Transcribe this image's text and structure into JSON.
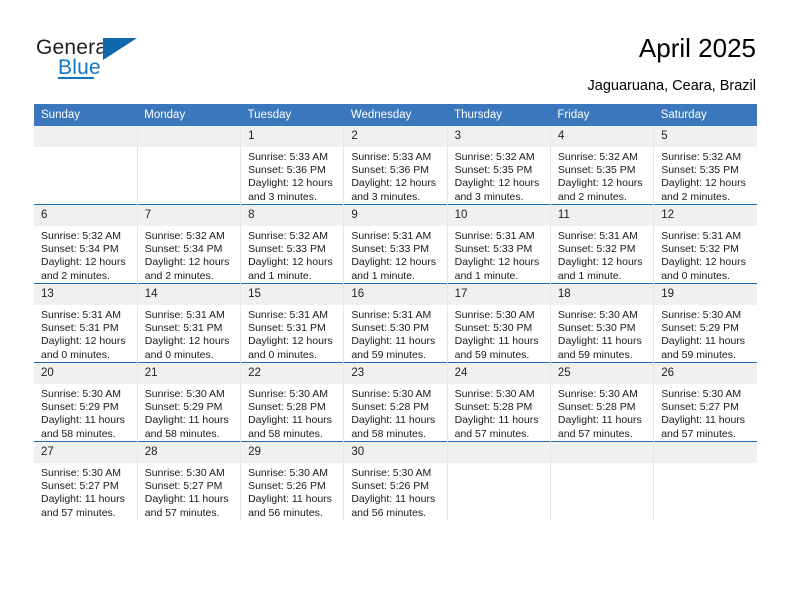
{
  "logo": {
    "word_one": "General",
    "word_two": "Blue",
    "triangle_icon": "triangle-icon"
  },
  "header": {
    "title": "April 2025",
    "location": "Jaguaruana, Ceara, Brazil"
  },
  "colors": {
    "header_blue": "#3b77bc",
    "row_divider_blue": "#1f6cb0",
    "daynum_background": "#f0f0f0",
    "logo_blue": "#1176c4",
    "column_divider": "#e6e6e6"
  },
  "calendar": {
    "weekdays": [
      "Sunday",
      "Monday",
      "Tuesday",
      "Wednesday",
      "Thursday",
      "Friday",
      "Saturday"
    ],
    "weeks": [
      [
        {
          "day": "",
          "sunrise": "",
          "sunset": "",
          "daylight": ""
        },
        {
          "day": "",
          "sunrise": "",
          "sunset": "",
          "daylight": ""
        },
        {
          "day": "1",
          "sunrise": "Sunrise: 5:33 AM",
          "sunset": "Sunset: 5:36 PM",
          "daylight": "Daylight: 12 hours and 3 minutes."
        },
        {
          "day": "2",
          "sunrise": "Sunrise: 5:33 AM",
          "sunset": "Sunset: 5:36 PM",
          "daylight": "Daylight: 12 hours and 3 minutes."
        },
        {
          "day": "3",
          "sunrise": "Sunrise: 5:32 AM",
          "sunset": "Sunset: 5:35 PM",
          "daylight": "Daylight: 12 hours and 3 minutes."
        },
        {
          "day": "4",
          "sunrise": "Sunrise: 5:32 AM",
          "sunset": "Sunset: 5:35 PM",
          "daylight": "Daylight: 12 hours and 2 minutes."
        },
        {
          "day": "5",
          "sunrise": "Sunrise: 5:32 AM",
          "sunset": "Sunset: 5:35 PM",
          "daylight": "Daylight: 12 hours and 2 minutes."
        }
      ],
      [
        {
          "day": "6",
          "sunrise": "Sunrise: 5:32 AM",
          "sunset": "Sunset: 5:34 PM",
          "daylight": "Daylight: 12 hours and 2 minutes."
        },
        {
          "day": "7",
          "sunrise": "Sunrise: 5:32 AM",
          "sunset": "Sunset: 5:34 PM",
          "daylight": "Daylight: 12 hours and 2 minutes."
        },
        {
          "day": "8",
          "sunrise": "Sunrise: 5:32 AM",
          "sunset": "Sunset: 5:33 PM",
          "daylight": "Daylight: 12 hours and 1 minute."
        },
        {
          "day": "9",
          "sunrise": "Sunrise: 5:31 AM",
          "sunset": "Sunset: 5:33 PM",
          "daylight": "Daylight: 12 hours and 1 minute."
        },
        {
          "day": "10",
          "sunrise": "Sunrise: 5:31 AM",
          "sunset": "Sunset: 5:33 PM",
          "daylight": "Daylight: 12 hours and 1 minute."
        },
        {
          "day": "11",
          "sunrise": "Sunrise: 5:31 AM",
          "sunset": "Sunset: 5:32 PM",
          "daylight": "Daylight: 12 hours and 1 minute."
        },
        {
          "day": "12",
          "sunrise": "Sunrise: 5:31 AM",
          "sunset": "Sunset: 5:32 PM",
          "daylight": "Daylight: 12 hours and 0 minutes."
        }
      ],
      [
        {
          "day": "13",
          "sunrise": "Sunrise: 5:31 AM",
          "sunset": "Sunset: 5:31 PM",
          "daylight": "Daylight: 12 hours and 0 minutes."
        },
        {
          "day": "14",
          "sunrise": "Sunrise: 5:31 AM",
          "sunset": "Sunset: 5:31 PM",
          "daylight": "Daylight: 12 hours and 0 minutes."
        },
        {
          "day": "15",
          "sunrise": "Sunrise: 5:31 AM",
          "sunset": "Sunset: 5:31 PM",
          "daylight": "Daylight: 12 hours and 0 minutes."
        },
        {
          "day": "16",
          "sunrise": "Sunrise: 5:31 AM",
          "sunset": "Sunset: 5:30 PM",
          "daylight": "Daylight: 11 hours and 59 minutes."
        },
        {
          "day": "17",
          "sunrise": "Sunrise: 5:30 AM",
          "sunset": "Sunset: 5:30 PM",
          "daylight": "Daylight: 11 hours and 59 minutes."
        },
        {
          "day": "18",
          "sunrise": "Sunrise: 5:30 AM",
          "sunset": "Sunset: 5:30 PM",
          "daylight": "Daylight: 11 hours and 59 minutes."
        },
        {
          "day": "19",
          "sunrise": "Sunrise: 5:30 AM",
          "sunset": "Sunset: 5:29 PM",
          "daylight": "Daylight: 11 hours and 59 minutes."
        }
      ],
      [
        {
          "day": "20",
          "sunrise": "Sunrise: 5:30 AM",
          "sunset": "Sunset: 5:29 PM",
          "daylight": "Daylight: 11 hours and 58 minutes."
        },
        {
          "day": "21",
          "sunrise": "Sunrise: 5:30 AM",
          "sunset": "Sunset: 5:29 PM",
          "daylight": "Daylight: 11 hours and 58 minutes."
        },
        {
          "day": "22",
          "sunrise": "Sunrise: 5:30 AM",
          "sunset": "Sunset: 5:28 PM",
          "daylight": "Daylight: 11 hours and 58 minutes."
        },
        {
          "day": "23",
          "sunrise": "Sunrise: 5:30 AM",
          "sunset": "Sunset: 5:28 PM",
          "daylight": "Daylight: 11 hours and 58 minutes."
        },
        {
          "day": "24",
          "sunrise": "Sunrise: 5:30 AM",
          "sunset": "Sunset: 5:28 PM",
          "daylight": "Daylight: 11 hours and 57 minutes."
        },
        {
          "day": "25",
          "sunrise": "Sunrise: 5:30 AM",
          "sunset": "Sunset: 5:28 PM",
          "daylight": "Daylight: 11 hours and 57 minutes."
        },
        {
          "day": "26",
          "sunrise": "Sunrise: 5:30 AM",
          "sunset": "Sunset: 5:27 PM",
          "daylight": "Daylight: 11 hours and 57 minutes."
        }
      ],
      [
        {
          "day": "27",
          "sunrise": "Sunrise: 5:30 AM",
          "sunset": "Sunset: 5:27 PM",
          "daylight": "Daylight: 11 hours and 57 minutes."
        },
        {
          "day": "28",
          "sunrise": "Sunrise: 5:30 AM",
          "sunset": "Sunset: 5:27 PM",
          "daylight": "Daylight: 11 hours and 57 minutes."
        },
        {
          "day": "29",
          "sunrise": "Sunrise: 5:30 AM",
          "sunset": "Sunset: 5:26 PM",
          "daylight": "Daylight: 11 hours and 56 minutes."
        },
        {
          "day": "30",
          "sunrise": "Sunrise: 5:30 AM",
          "sunset": "Sunset: 5:26 PM",
          "daylight": "Daylight: 11 hours and 56 minutes."
        },
        {
          "day": "",
          "sunrise": "",
          "sunset": "",
          "daylight": ""
        },
        {
          "day": "",
          "sunrise": "",
          "sunset": "",
          "daylight": ""
        },
        {
          "day": "",
          "sunrise": "",
          "sunset": "",
          "daylight": ""
        }
      ]
    ]
  }
}
